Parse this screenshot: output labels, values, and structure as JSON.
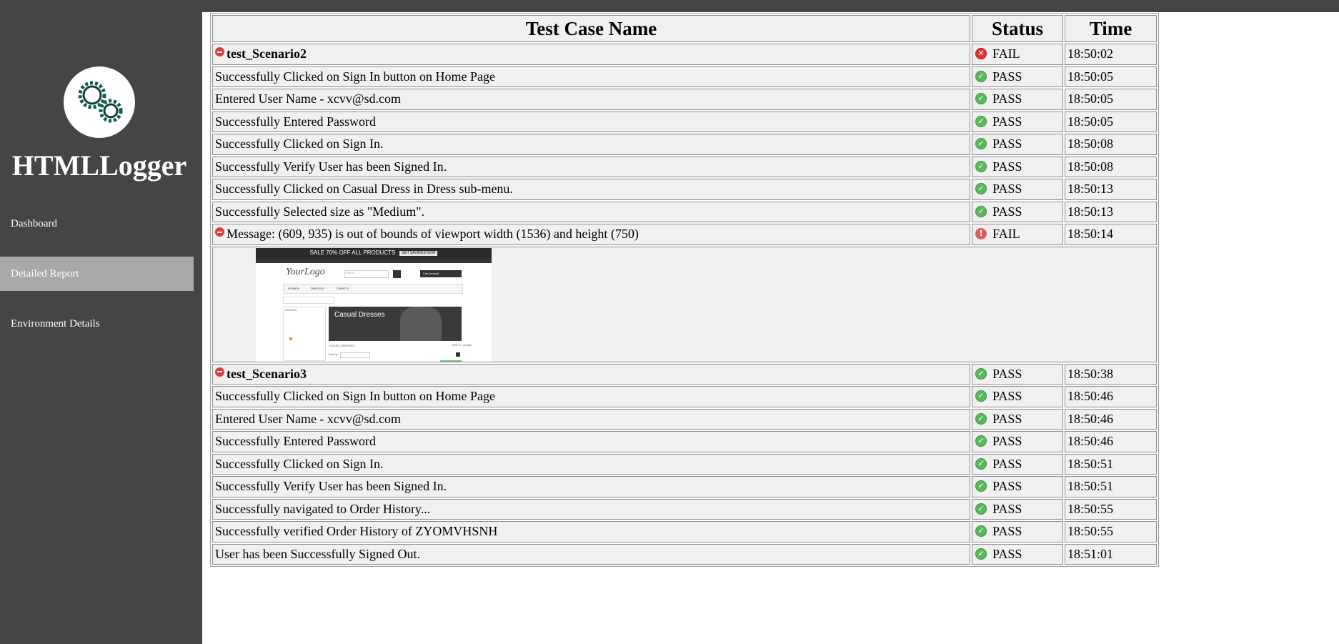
{
  "sidebar": {
    "brand": "HTMLLogger",
    "nav": [
      {
        "label": "Dashboard",
        "active": false
      },
      {
        "label": "Detailed Report",
        "active": true
      },
      {
        "label": "Environment Details",
        "active": false
      }
    ],
    "logo_icon": "gears-icon"
  },
  "table": {
    "headers": {
      "name": "Test Case Name",
      "status": "Status",
      "time": "Time"
    },
    "scenario2": {
      "title": "test_Scenario2",
      "status": "FAIL",
      "time": "18:50:02",
      "steps": [
        {
          "name": "Successfully Clicked on Sign In button on Home Page",
          "status": "PASS",
          "time": "18:50:05"
        },
        {
          "name": "Entered User Name - xcvv@sd.com",
          "status": "PASS",
          "time": "18:50:05"
        },
        {
          "name": "Successfully Entered Password",
          "status": "PASS",
          "time": "18:50:05"
        },
        {
          "name": "Successfully Clicked on Sign In.",
          "status": "PASS",
          "time": "18:50:08"
        },
        {
          "name": "Successfully Verify User has been Signed In.",
          "status": "PASS",
          "time": "18:50:08"
        },
        {
          "name": "Successfully Clicked on Casual Dress in Dress sub-menu.",
          "status": "PASS",
          "time": "18:50:13"
        },
        {
          "name": "Successfully Selected size as \"Medium\".",
          "status": "PASS",
          "time": "18:50:13"
        }
      ],
      "error": {
        "message": "Message: (609, 935) is out of bounds of viewport width (1536) and height (750)",
        "status": "FAIL",
        "time": "18:50:14"
      }
    },
    "screenshot": {
      "banner": "SALE 70% OFF ALL PRODUCTS",
      "banner_button": "GET SAVINGS NOW",
      "logo": "YourLogo",
      "search_placeholder": "Search",
      "cart": "Cart (empty)",
      "menu": [
        "WOMEN",
        "DRESSES",
        "T-SHIRTS"
      ],
      "catalog": "CATALOG",
      "hero_title": "Casual Dresses",
      "subheading": "CASUAL DRESSES",
      "sort_label": "Sort by",
      "view_label": "View",
      "showing": "There is 1 product."
    },
    "scenario3": {
      "title": "test_Scenario3",
      "status": "PASS",
      "time": "18:50:38",
      "steps": [
        {
          "name": "Successfully Clicked on Sign In button on Home Page",
          "status": "PASS",
          "time": "18:50:46"
        },
        {
          "name": "Entered User Name - xcvv@sd.com",
          "status": "PASS",
          "time": "18:50:46"
        },
        {
          "name": "Successfully Entered Password",
          "status": "PASS",
          "time": "18:50:46"
        },
        {
          "name": "Successfully Clicked on Sign In.",
          "status": "PASS",
          "time": "18:50:51"
        },
        {
          "name": "Successfully Verify User has been Signed In.",
          "status": "PASS",
          "time": "18:50:51"
        },
        {
          "name": "Successfully navigated to Order History...",
          "status": "PASS",
          "time": "18:50:55"
        },
        {
          "name": "Successfully verified Order History of ZYOMVHSNH",
          "status": "PASS",
          "time": "18:50:55"
        },
        {
          "name": "User has been Successfully Signed Out.",
          "status": "PASS",
          "time": "18:51:01"
        }
      ]
    }
  },
  "colors": {
    "sidebar_bg": "#454545",
    "active_nav": "#a8a8a8",
    "pass": "#5cb85c",
    "fail": "#e03232",
    "error_text": "#e00000"
  }
}
